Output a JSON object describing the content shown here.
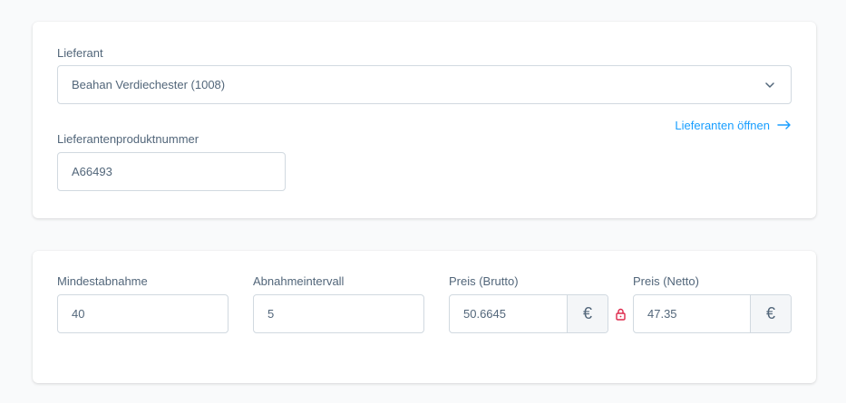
{
  "supplier": {
    "label": "Lieferant",
    "value": "Beahan Verdiechester (1008)",
    "open_link": "Lieferanten öffnen"
  },
  "supplier_product_number": {
    "label": "Lieferantenproduktnummer",
    "value": "A66493"
  },
  "min_purchase": {
    "label": "Mindestabnahme",
    "value": "40"
  },
  "purchase_steps": {
    "label": "Abnahmeintervall",
    "value": "5"
  },
  "price_gross": {
    "label": "Preis (Brutto)",
    "value": "50.6645",
    "currency": "€"
  },
  "price_net": {
    "label": "Preis (Netto)",
    "value": "47.35",
    "currency": "€"
  },
  "colors": {
    "accent": "#189eff",
    "lock": "#de294c"
  }
}
